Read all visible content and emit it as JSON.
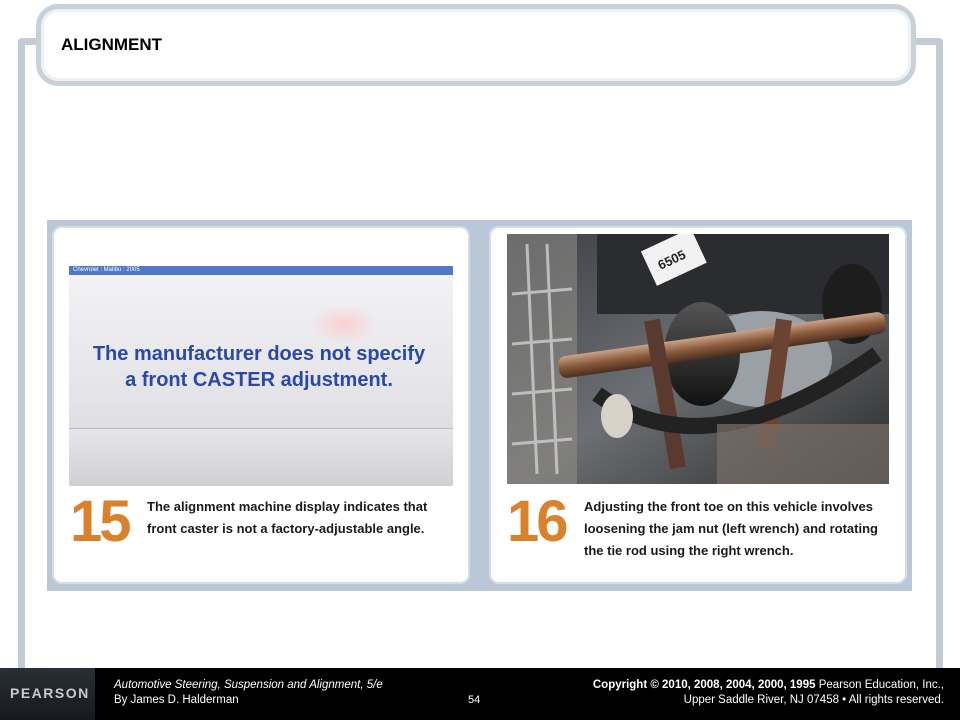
{
  "slide": {
    "title": "ALIGNMENT"
  },
  "figures": [
    {
      "number": "15",
      "caption": "The alignment machine display indicates that front caster is not a factory-adjustable angle.",
      "screen_header": "Chevrolet : Malibu : 2005",
      "screen_message": "The manufacturer does not specify a front CASTER adjustment."
    },
    {
      "number": "16",
      "caption": "Adjusting the front toe on this vehicle involves loosening the jam nut (left wrench) and rotating the tie rod using the right wrench.",
      "tag_text": "6505"
    }
  ],
  "footer": {
    "logo": "PEARSON",
    "book_title": "Automotive Steering, Suspension and Alignment, 5/e",
    "book_author": "By James D. Halderman",
    "page_number": "54",
    "copyright_prefix": "Copyright ©",
    "copyright_years": " 2010, 2008, 2004, 2000, 1995",
    "copyright_publisher": " Pearson Education, Inc.,",
    "copyright_line2": "Upper Saddle River, NJ 07458 • All rights reserved."
  },
  "colors": {
    "accent_number": "#d9822b",
    "screen_text": "#2a48a8",
    "frame": "#c3ccd4"
  }
}
